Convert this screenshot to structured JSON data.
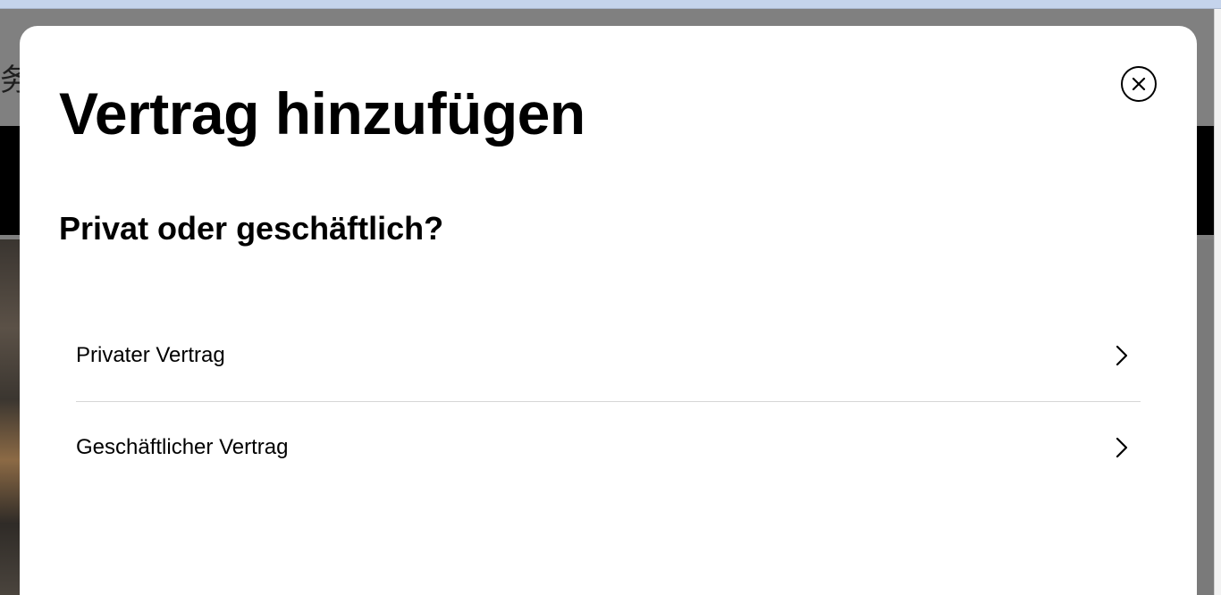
{
  "background": {
    "header_glyph": "务"
  },
  "modal": {
    "title": "Vertrag hinzufügen",
    "subtitle": "Privat oder geschäftlich?",
    "options": [
      {
        "label": "Privater Vertrag",
        "icon": "chevron-right-icon"
      },
      {
        "label": "Geschäftlicher Vertrag",
        "icon": "chevron-right-icon"
      }
    ],
    "close_icon": "close-icon"
  },
  "colors": {
    "overlay": "#7f7f7f",
    "modal_bg": "#ffffff",
    "text": "#000000",
    "divider": "#d6d6d6"
  }
}
